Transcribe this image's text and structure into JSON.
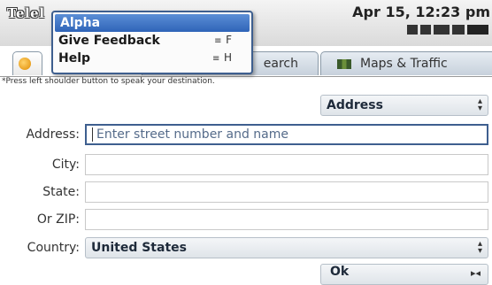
{
  "app": {
    "title": "Telel"
  },
  "status": {
    "datetime": "Apr 15, 12:23 pm"
  },
  "tabs": [
    {
      "label": ""
    },
    {
      "label": "earch"
    },
    {
      "label": "Maps & Traffic"
    }
  ],
  "hint": "*Press left shoulder button to speak your destination.",
  "address_type": {
    "value": "Address"
  },
  "form": {
    "address_label": "Address:",
    "address_placeholder": "Enter street number and name",
    "city_label": "City:",
    "state_label": "State:",
    "zip_label": "Or ZIP:",
    "country_label": "Country:",
    "country_value": "United States",
    "ok_label": "Ok"
  },
  "menu": {
    "items": [
      {
        "label": "Alpha",
        "shortcut": ""
      },
      {
        "label": "Give Feedback",
        "shortcut": "F"
      },
      {
        "label": "Help",
        "shortcut": "H"
      }
    ]
  },
  "icons": {
    "home": "home-icon",
    "maps": "map-icon",
    "updown": "up-down-arrow-icon"
  }
}
